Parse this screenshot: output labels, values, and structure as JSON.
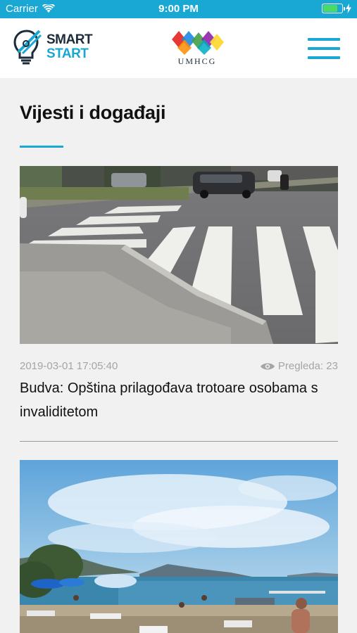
{
  "status_bar": {
    "carrier": "Carrier",
    "time": "9:00 PM"
  },
  "header": {
    "logo_line1": "SMART",
    "logo_line2": "START",
    "partner_logo_text": "UMHCG",
    "menu_icon": "hamburger-menu-icon"
  },
  "page": {
    "title": "Vijesti i događaji"
  },
  "news": [
    {
      "date": "2019-03-01 17:05:40",
      "views_label": "Pregleda: 23",
      "title": "Budva: Opština prilagođava trotoare osobama s invaliditetom",
      "image": "street-crosswalk-photo"
    },
    {
      "image": "beach-sea-photo"
    }
  ],
  "colors": {
    "accent": "#19a7d4",
    "background": "#f1f1f1",
    "battery": "#4cd964"
  }
}
